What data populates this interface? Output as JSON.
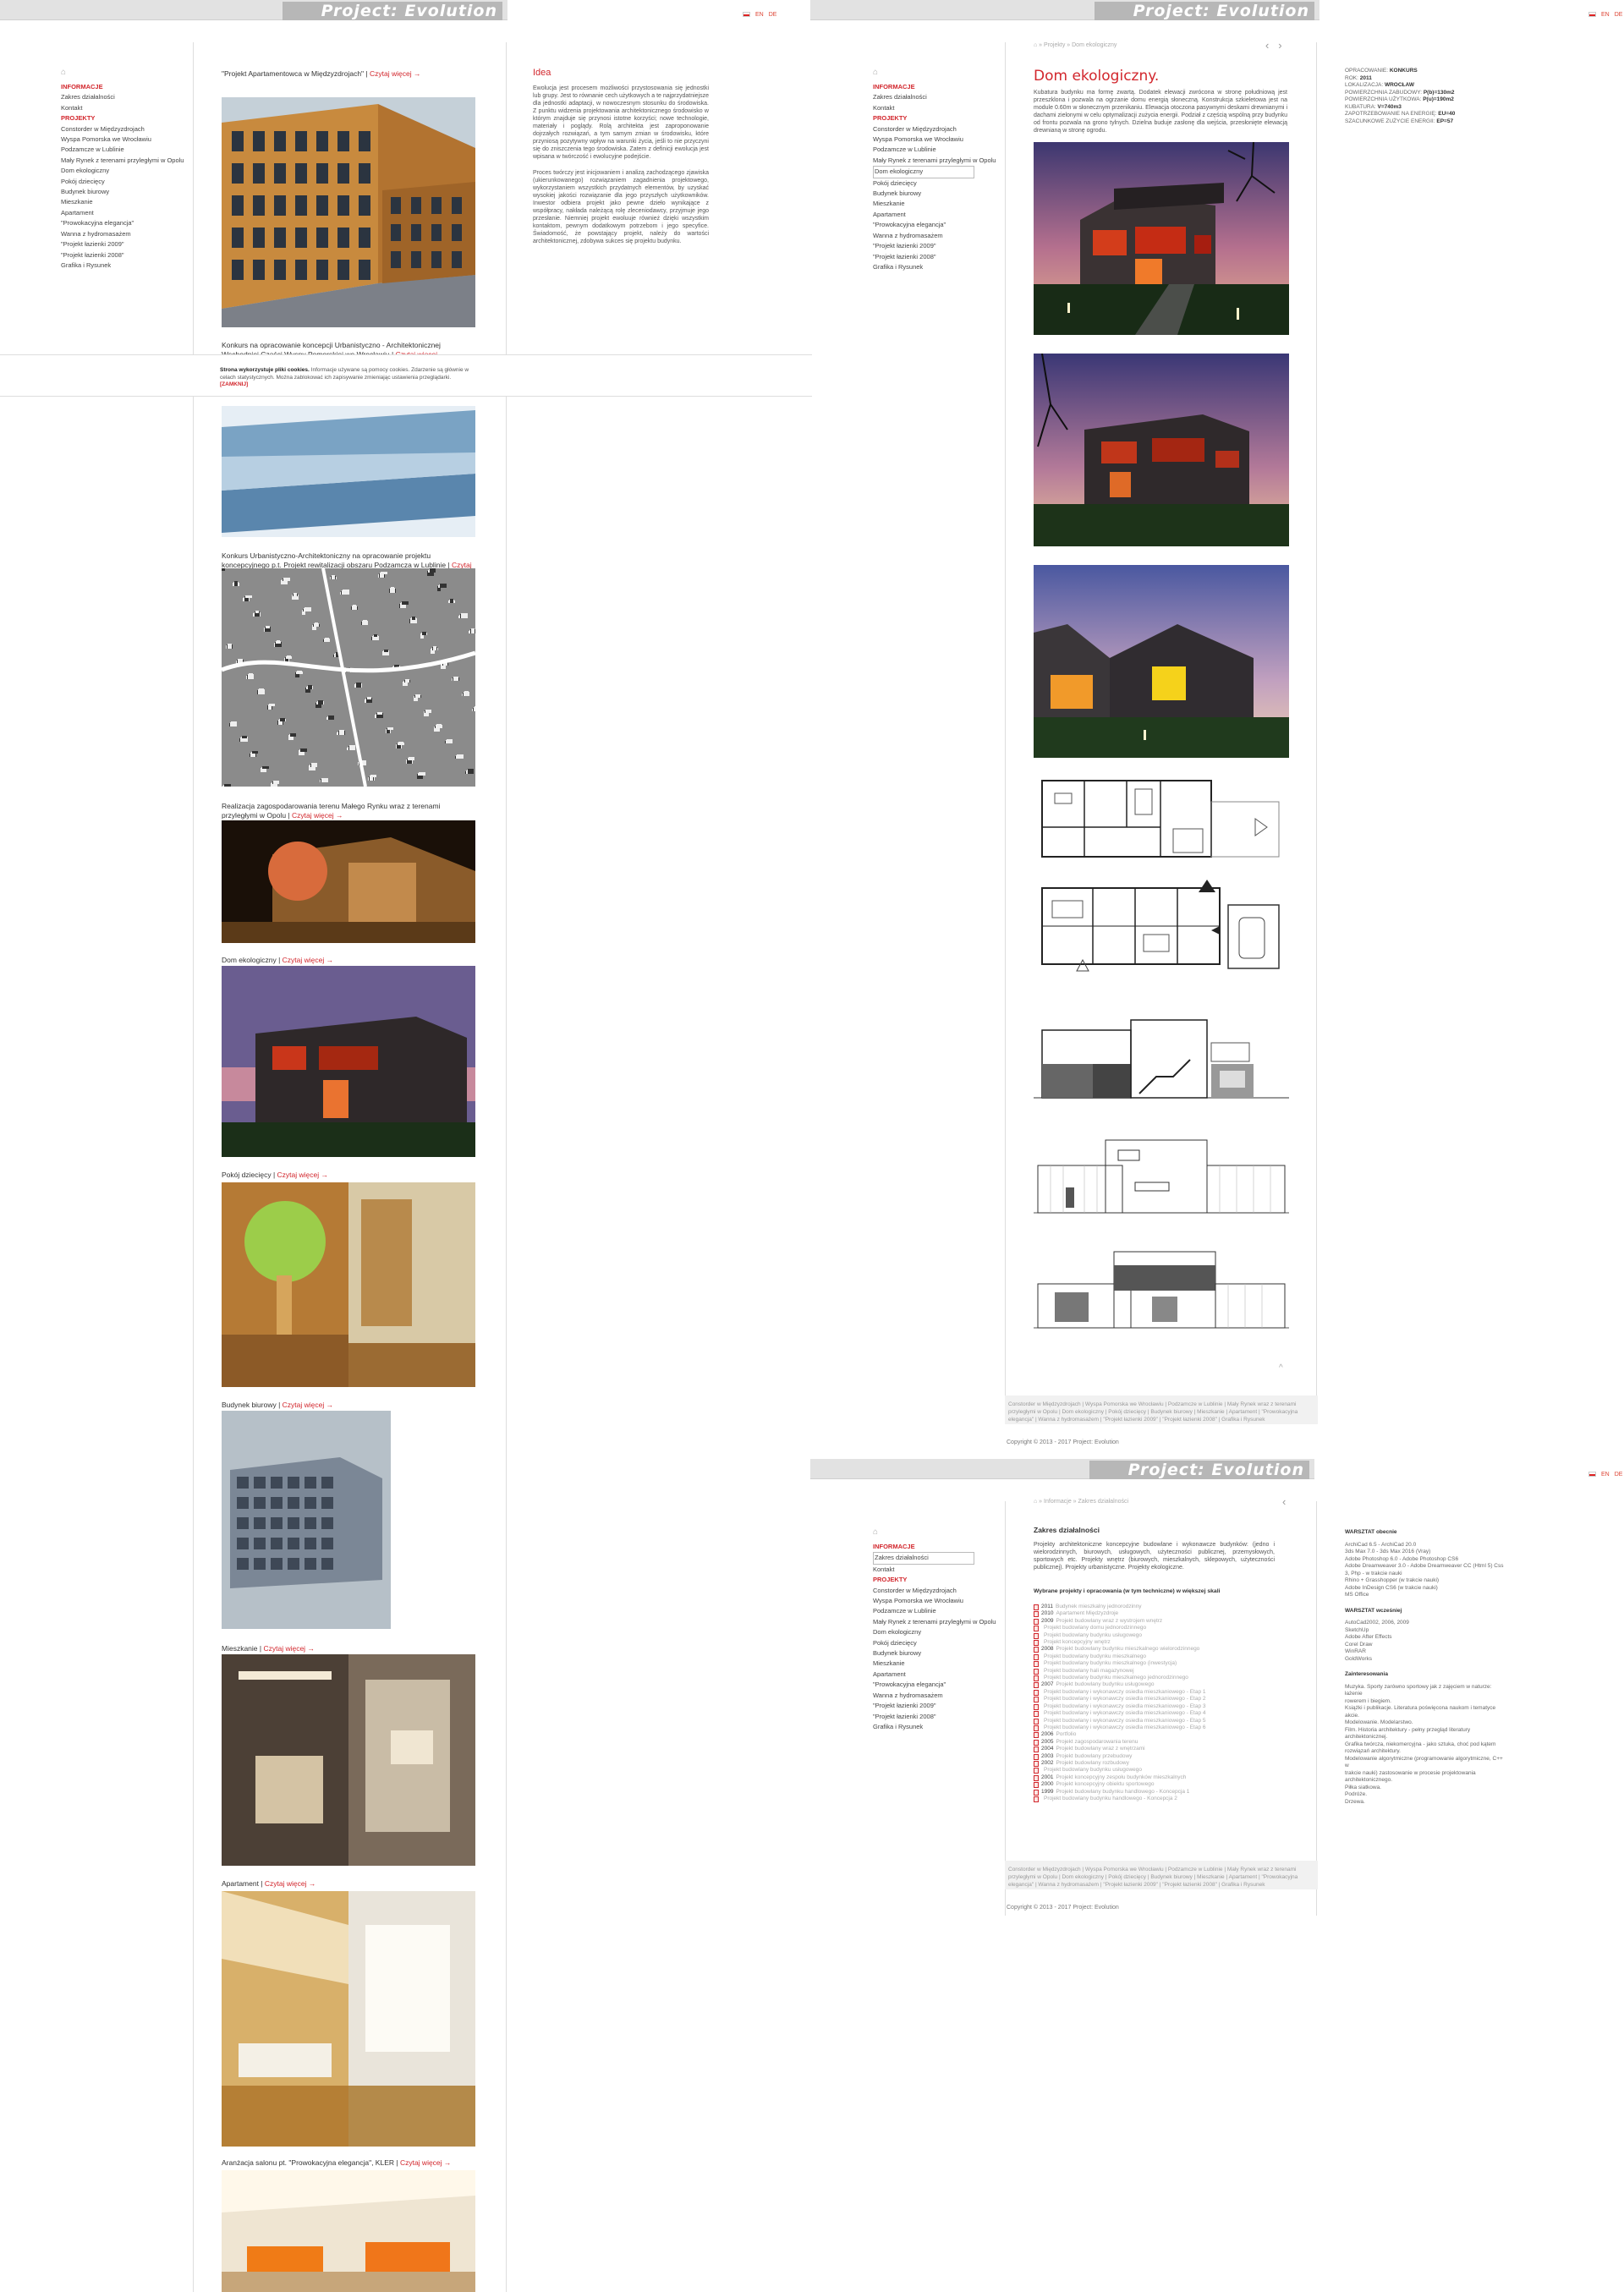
{
  "brand": "Project: Evolution",
  "flags": [
    "EN",
    "DE"
  ],
  "nav": {
    "items": [
      "INFORMACJE",
      "Zakres działalności",
      "Kontakt",
      "PROJEKTY",
      "Constorder w Międzyzdrojach",
      "Wyspa Pomorska we Wrocławiu",
      "Podzamcze w Lublinie",
      "Mały Rynek z terenami przyległymi w Opolu",
      "Dom ekologiczny",
      "Pokój dziecięcy",
      "Budynek biurowy",
      "Mieszkanie",
      "Apartament",
      "\"Prowokacyjna elegancja\"",
      "Wanna z hydromasażem",
      "\"Projekt łazienki 2009\"",
      "\"Projekt łazienki 2008\"",
      "Grafika i Rysunek"
    ]
  },
  "listing": {
    "more_label": "Czytaj więcej",
    "projects": [
      {
        "title": "\"Projekt Apartamentowca w Międzyzdrojach\""
      },
      {
        "title": "Konkurs na opracowanie koncepcji Urbanistyczno - Architektonicznej Wschodniej Części Wyspy Pomorskiej we Wrocławiu"
      },
      {
        "title": "Konkurs Urbanistyczno-Architektoniczny na opracowanie projektu koncepcyjnego p.t. Projekt rewitalizacji obszaru Podzamcza w Lublinie"
      },
      {
        "title": "Realizacja zagospodarowania terenu Małego Rynku wraz z terenami przyległymi w Opolu"
      },
      {
        "title": "Dom ekologiczny"
      },
      {
        "title": "Pokój dziecięcy"
      },
      {
        "title": "Budynek biurowy"
      },
      {
        "title": "Mieszkanie"
      },
      {
        "title": "Apartament"
      },
      {
        "title": "Aranżacja salonu pt. \"Prowokacyjna elegancja\", KLER"
      }
    ]
  },
  "idea": {
    "heading": "Idea",
    "p1": "Ewolucja jest procesem możliwości przystosowania się jednostki lub grupy. Jest to równanie cech użytkowych a te najprzydatniejsze dla jednostki adaptacji, w nowoczesnym stosunku do środowiska. Z punktu widzenia projektowania architektonicznego środowisko w którym znajduje się przynosi istotne korzyści; nowe technologie, materiały i poglądy. Rolą architekta jest zaproponowanie dojrzałych rozwiązań, a tym samym zmian w środowisku, które przyniosą pozytywny wpływ na warunki życia, jeśli to nie przyczyni się do zniszczenia tego środowiska. Zatem z definicji ewolucja jest wpisana w twórczość i ewolucyjne podejście.",
    "p2": "Proces twórczy jest inicjowaniem i analizą zachodzącego zjawiska (ukierunkowanego) rozwiązaniem zagadnienia projektowego, wykorzystaniem wszystkich przydatnych elementów, by uzyskać wysokiej jakości rozwiązanie dla jego przyszłych użytkowników. Inwestor odbiera projekt jako pewne dzieło wynikające z współpracy, nakłada należącą rolę zleceniodawcy, przyjmuje jego przesłanie. Niemniej projekt ewoluuje również dzięki wszystkim kontaktom, pewnym dodatkowym potrzebom i jego specyfice. Świadomość, że powstający projekt, należy do wartości architektonicznej, zdobywa sukces się projektu budynku."
  },
  "cookie": {
    "bold": "Strona wykorzystuje pliki cookies.",
    "text": "Informacje używane są pomocy cookies. Zdarzenie są głównie w celach statystycznych. Można zablokować ich zapisywanie zmieniając ustawienia przeglądarki.",
    "close": "[ZAMKNIJ]"
  },
  "detail": {
    "breadcrumb": [
      "Projekty",
      "Dom ekologiczny"
    ],
    "title": "Dom ekologiczny.",
    "text": "Kubatura budynku ma formę zwartą. Dodatek elewacji zwrócona w stronę południową jest przeszklona i pozwala na ogrzanie domu energią słoneczną. Konstrukcja szkieletowa jest na module 0.60m w słonecznym przenikaniu. Elewacja otoczona pasywnymi deskami drewnianymi i dachami zielonymi w celu optymalizacji zużycia energii. Podział z częścią wspólną przy budynku od frontu pozwala na grono tylnych. Dzielna buduje zasłonę dla wejścia, przesłonięte elewacją drewnianą w stronę ogrodu.",
    "spec": [
      {
        "k": "OPRACOWANIE:",
        "v": "KONKURS"
      },
      {
        "k": "ROK:",
        "v": "2011"
      },
      {
        "k": "LOKALIZACJA:",
        "v": "WROCŁAW"
      },
      {
        "k": "POWIERZCHNIA ZABUDOWY:",
        "v": "P(b)=130m2"
      },
      {
        "k": "POWIERZCHNIA UŻYTKOWA:",
        "v": "P(u)=190m2"
      },
      {
        "k": "KUBATURA:",
        "v": "V=740m3"
      },
      {
        "k": "ZAPOTRZEBOWANIE NA ENERGIĘ:",
        "v": "EU=40"
      },
      {
        "k": "SZACUNKOWE ZUŻYCIE ENERGII:",
        "v": "EP=57"
      }
    ]
  },
  "footer": {
    "links": "Constorder w Międzyzdrojach | Wyspa Pomorska we Wrocławiu | Podzamcze w Lublinie | Mały Rynek wraz z terenami przyległymi w Opolu | Dom ekologiczny | Pokój dziecięcy | Budynek biurowy | Mieszkanie | Apartament | \"Prowokacyjna elegancja\" | Wanna z hydromasażem | \"Projekt łazienki 2009\" | \"Projekt łazienki 2008\" | Grafika i Rysunek",
    "copyright": "Copyright © 2013 - 2017 Project: Evolution"
  },
  "zakres": {
    "breadcrumb": [
      "Informacje",
      "Zakres działalności"
    ],
    "title": "Zakres działalności",
    "intro": "Projekty architektoniczne koncepcyjne budowlane i wykonawcze budynków: (jedno i wielorodzinnych, biurowych, usługowych, użyteczności publicznej, przemysłowych, sportowych etc. Projekty wnętrz (biurowych, mieszkalnych, sklepowych, użyteczności publicznej). Projekty urbanistyczne. Projekty ekologiczne.",
    "list_heading": "Wybrane projekty i opracowania (w tym techniczne) w większej skali",
    "years": [
      {
        "year": "2011",
        "text": "Budynek mieszkalny jednorodzinny"
      },
      {
        "year": "2010",
        "text": "Apartament Międzyzdroje"
      },
      {
        "year": "2009",
        "text": "Projekt budowlany wraz z wystrojem wnętrz"
      },
      {
        "year": "",
        "text": "Projekt budowlany domu jednorodzinnego"
      },
      {
        "year": "",
        "text": "Projekt budowlany budynku usługowego"
      },
      {
        "year": "",
        "text": "Projekt koncepcyjny wnętrz"
      },
      {
        "year": "2008",
        "text": "Projekt budowlany budynku mieszkalnego wielorodzinnego"
      },
      {
        "year": "",
        "text": "Projekt budowlany budynku mieszkalnego"
      },
      {
        "year": "",
        "text": "Projekt budowlany budynku mieszkalnego (inwestycja)"
      },
      {
        "year": "",
        "text": "Projekt budowlany hali magazynowej"
      },
      {
        "year": "",
        "text": "Projekt budowlany budynku mieszkalnego jednorodzinnego"
      },
      {
        "year": "2007",
        "text": "Projekt budowlany budynku usługowego"
      },
      {
        "year": "",
        "text": "Projekt budowlany i wykonawczy osiedla mieszkaniowego - Etap 1"
      },
      {
        "year": "",
        "text": "Projekt budowlany i wykonawczy osiedla mieszkaniowego - Etap 2"
      },
      {
        "year": "",
        "text": "Projekt budowlany i wykonawczy osiedla mieszkaniowego - Etap 3"
      },
      {
        "year": "",
        "text": "Projekt budowlany i wykonawczy osiedla mieszkaniowego - Etap 4"
      },
      {
        "year": "",
        "text": "Projekt budowlany i wykonawczy osiedla mieszkaniowego - Etap 5"
      },
      {
        "year": "",
        "text": "Projekt budowlany i wykonawczy osiedla mieszkaniowego - Etap 6"
      },
      {
        "year": "2006",
        "text": "Portfolio"
      },
      {
        "year": "2005",
        "text": "Projekt zagospodarowania terenu"
      },
      {
        "year": "2004",
        "text": "Projekt budowlany wraz z wnętrzami"
      },
      {
        "year": "2003",
        "text": "Projekt budowlany przebudowy"
      },
      {
        "year": "2002",
        "text": "Projekt budowlany rozbudowy"
      },
      {
        "year": "",
        "text": "Projekt budowlany budynku usługowego"
      },
      {
        "year": "2001",
        "text": "Projekt koncepcyjny zespołu budynków mieszkalnych"
      },
      {
        "year": "2000",
        "text": "Projekt koncepcyjny obiektu sportowego"
      },
      {
        "year": "1999",
        "text": "Projekt budowlany budynku handlowego - Koncepcja 1"
      },
      {
        "year": "",
        "text": "Projekt budowlany budynku handlowego - Koncepcja 2"
      }
    ],
    "side": {
      "h1": "WARSZTAT obecnie",
      "t1": "ArchiCad 6.5 - ArchiCad 20.0\n3ds Max 7.0 - 3ds Max 2016 (Vray)\nAdobe Photoshop 6.0 - Adobe Photoshop CS6\nAdobe Dreamweaver 3.0 - Adobe Dreamweaver CC (Html 5) Css 3, Php - w trakcie nauki\nRhino + Grasshopper (w trakcie nauki)\nAdobe InDesign CS6 (w trakcie nauki)\nMS Office",
      "h2": "WARSZTAT wcześniej",
      "t2": "AutoCad2002, 2006, 2009\nSketchUp\nAdobe After Effects\nCorel Draw\nWinRAR\nGoldWorks",
      "h3": "Zainteresowania",
      "t3": "Muzyka. Sporty zarówno sportowy jak z zajęciem w naturze: łażenie\nrowerem i biegiem.\nKsiążki i publikacje. Literatura poświęcona naukom i tematyce akcie.\nModelowanie. Modelarstwo.\nFilm. Historia architektury - pełny przegląd literatury architektonicznej.\nGrafika twórcza, niekomercyjna - jako sztuka, choć pod kątem\nrozwiązań architektury.\nModelowanie algorytmiczne (programowanie algorytmiczne, C++ w\ntrakcie nauki) zastosowanie w procesie projektowania architektonicznego.\nPiłka siatkowa.\nPodróże.\nDrzewa."
    }
  }
}
